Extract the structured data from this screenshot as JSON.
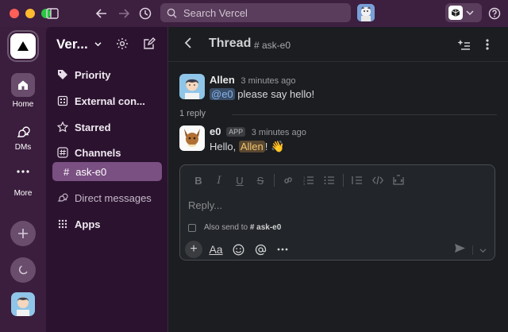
{
  "titlebar": {
    "search_placeholder": "Search Vercel"
  },
  "rail": {
    "home_label": "Home",
    "dms_label": "DMs",
    "more_label": "More"
  },
  "sidebar": {
    "workspace_name": "Ver...",
    "items": [
      {
        "label": "Priority",
        "icon": "tag-icon"
      },
      {
        "label": "External con...",
        "icon": "building-icon"
      },
      {
        "label": "Starred",
        "icon": "star-icon"
      },
      {
        "label": "Channels",
        "icon": "hash-icon"
      },
      {
        "label": "ask-e0",
        "icon": "hash-icon",
        "active": true
      },
      {
        "label": "Direct messages",
        "icon": "dm-icon"
      },
      {
        "label": "Apps",
        "icon": "apps-grid-icon"
      }
    ]
  },
  "thread": {
    "title": "Thread",
    "channel": "# ask-e0"
  },
  "messages": [
    {
      "author": "Allen",
      "time": "3 minutes ago",
      "mention": "@e0",
      "text": " please say hello!"
    },
    {
      "author": "e0",
      "badge": "APP",
      "time": "3 minutes ago",
      "text_before": "Hello, ",
      "mention": "Allen",
      "text_after": "! ",
      "emoji": "👋"
    }
  ],
  "reply_count": "1 reply",
  "composer": {
    "placeholder": "Reply...",
    "also_send_prefix": "Also send to",
    "also_send_channel": "# ask-e0",
    "format_label": "Aa"
  },
  "colors": {
    "rail_bg": "#3b1d3d",
    "sidebar_bg": "#2b1330",
    "active_item": "#7a4f82",
    "main_bg": "#1b1d21"
  }
}
